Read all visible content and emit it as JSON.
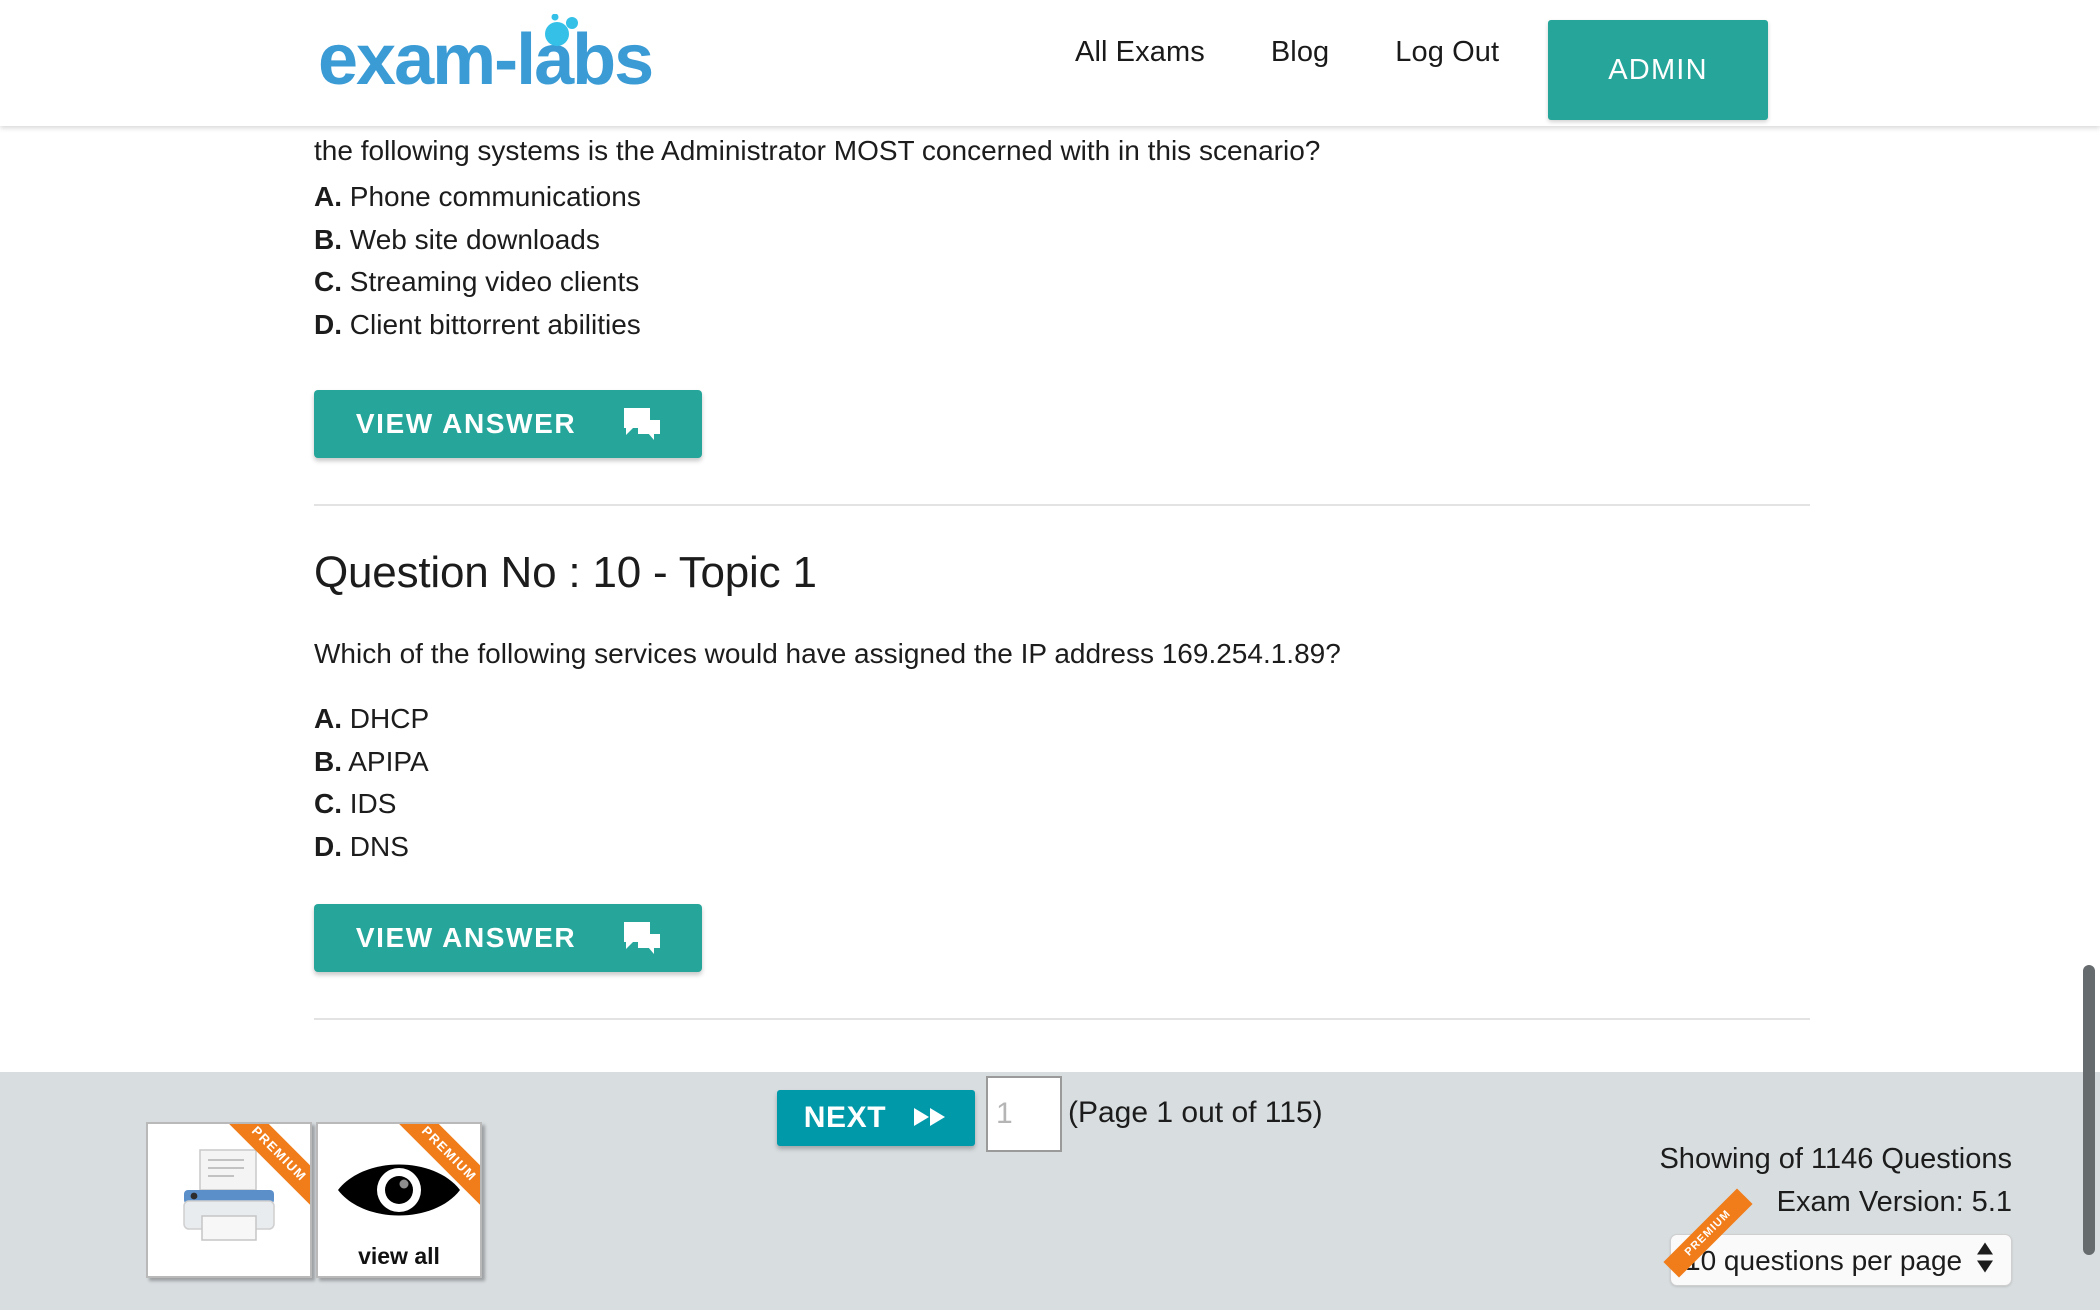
{
  "header": {
    "logo_text": "exam-labs",
    "logo_color": "#3a9bd5",
    "logo_bubble_color": "#35c0e8",
    "nav": [
      {
        "label": "All Exams",
        "name": "nav-all-exams"
      },
      {
        "label": "Blog",
        "name": "nav-blog"
      },
      {
        "label": "Log Out",
        "name": "nav-log-out"
      }
    ],
    "admin_button": "ADMIN",
    "admin_color": "#26a69a"
  },
  "questions": [
    {
      "heading": null,
      "text": "the following systems is the Administrator MOST concerned with in this scenario?",
      "options": [
        {
          "letter": "A.",
          "text": "Phone communications"
        },
        {
          "letter": "B.",
          "text": "Web site downloads"
        },
        {
          "letter": "C.",
          "text": "Streaming video clients"
        },
        {
          "letter": "D.",
          "text": "Client bittorrent abilities"
        }
      ],
      "view_answer_label": "VIEW ANSWER"
    },
    {
      "heading": "Question No : 10 - Topic 1",
      "text": "Which of the following services would have assigned the IP address 169.254.1.89?",
      "options": [
        {
          "letter": "A.",
          "text": "DHCP"
        },
        {
          "letter": "B.",
          "text": "APIPA"
        },
        {
          "letter": "C.",
          "text": "IDS"
        },
        {
          "letter": "D.",
          "text": "DNS"
        }
      ],
      "view_answer_label": "VIEW ANSWER"
    }
  ],
  "footer": {
    "premium_ribbon": "PREMIUM",
    "print_box_name": "print",
    "view_all_label": "view all",
    "next_label": "NEXT",
    "page_input_placeholder": "1",
    "page_input_value": "",
    "page_status": "(Page 1 out of 115)",
    "showing_questions": "Showing of 1146 Questions",
    "exam_version": "Exam Version: 5.1",
    "questions_per_page": "10 questions per page",
    "next_color": "#0099aa",
    "ribbon_color": "#f07d1a",
    "background_color": "#d8dde0"
  }
}
